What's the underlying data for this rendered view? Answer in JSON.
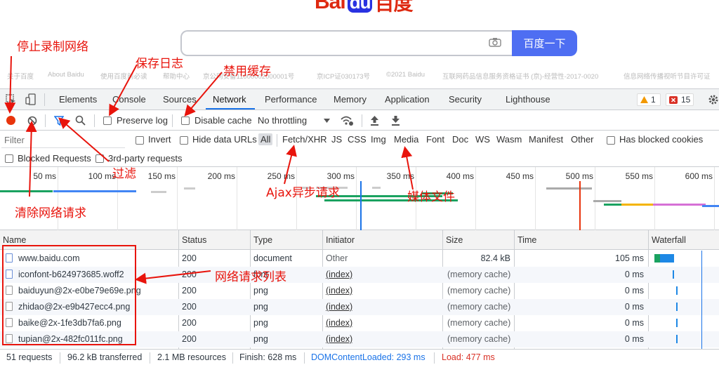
{
  "baidu": {
    "logo_bai": "Bai",
    "logo_du": "du",
    "logo_cn": "百度",
    "search_button": "百度一下",
    "footer": [
      "关于百度",
      "About Baidu",
      "使用百度前必读",
      "帮助中心",
      "京公网安备11000002000001号",
      "京ICP证030173号",
      "©2021 Baidu",
      "互联网药品信息服务资格证书 (京)-经营性-2017-0020",
      "信息网络传播视听节目许可证"
    ]
  },
  "tabs": {
    "items": [
      "Elements",
      "Console",
      "Sources",
      "Network",
      "Performance",
      "Memory",
      "Application",
      "Security",
      "Lighthouse"
    ],
    "active": "Network",
    "warnings": "1",
    "errors": "15"
  },
  "toolbar": {
    "preserve_log": "Preserve log",
    "disable_cache": "Disable cache",
    "throttling": "No throttling"
  },
  "filter": {
    "placeholder": "Filter",
    "invert": "Invert",
    "hide_data_urls": "Hide data URLs",
    "types": [
      "All",
      "Fetch/XHR",
      "JS",
      "CSS",
      "Img",
      "Media",
      "Font",
      "Doc",
      "WS",
      "Wasm",
      "Manifest",
      "Other"
    ],
    "has_blocked_cookies": "Has blocked cookies",
    "blocked_requests": "Blocked Requests",
    "third_party": "3rd-party requests"
  },
  "timeline": {
    "ticks": [
      "50 ms",
      "100 ms",
      "150 ms",
      "200 ms",
      "250 ms",
      "300 ms",
      "350 ms",
      "400 ms",
      "450 ms",
      "500 ms",
      "550 ms",
      "600 ms"
    ]
  },
  "table": {
    "columns": [
      "Name",
      "Status",
      "Type",
      "Initiator",
      "Size",
      "Time",
      "Waterfall"
    ],
    "rows": [
      {
        "name": "www.baidu.com",
        "status": "200",
        "type": "document",
        "initiator": "Other",
        "size": "82.4 kB",
        "time": "105 ms",
        "icon": "doc"
      },
      {
        "name": "iconfont-b624973685.woff2",
        "status": "200",
        "type": "font",
        "initiator": "(index)",
        "size": "(memory cache)",
        "time": "0 ms",
        "icon": "font"
      },
      {
        "name": "baiduyun@2x-e0be79e69e.png",
        "status": "200",
        "type": "png",
        "initiator": "(index)",
        "size": "(memory cache)",
        "time": "0 ms",
        "icon": "png"
      },
      {
        "name": "zhidao@2x-e9b427ecc4.png",
        "status": "200",
        "type": "png",
        "initiator": "(index)",
        "size": "(memory cache)",
        "time": "0 ms",
        "icon": "png"
      },
      {
        "name": "baike@2x-1fe3db7fa6.png",
        "status": "200",
        "type": "png",
        "initiator": "(index)",
        "size": "(memory cache)",
        "time": "0 ms",
        "icon": "png"
      },
      {
        "name": "tupian@2x-482fc011fc.png",
        "status": "200",
        "type": "png",
        "initiator": "(index)",
        "size": "(memory cache)",
        "time": "0 ms",
        "icon": "png"
      }
    ]
  },
  "status": {
    "requests": "51 requests",
    "transferred": "96.2 kB transferred",
    "resources": "2.1 MB resources",
    "finish": "Finish: 628 ms",
    "dom": "DOMContentLoaded: 293 ms",
    "load": "Load: 477 ms"
  },
  "annotations": {
    "stop_record": "停止录制网络",
    "save_log": "保存日志",
    "disable_cache": "禁用缓存",
    "filter": "过滤",
    "clear": "清除网络请求",
    "ajax": "Ajax异步请求",
    "media": "媒体文件",
    "list": "网络请求列表"
  },
  "colors": {
    "accent": "#1a73e8",
    "record": "#e8340c",
    "annotation": "#e8140c",
    "dom_content_loaded": "#1a73e8",
    "load": "#d93025"
  }
}
